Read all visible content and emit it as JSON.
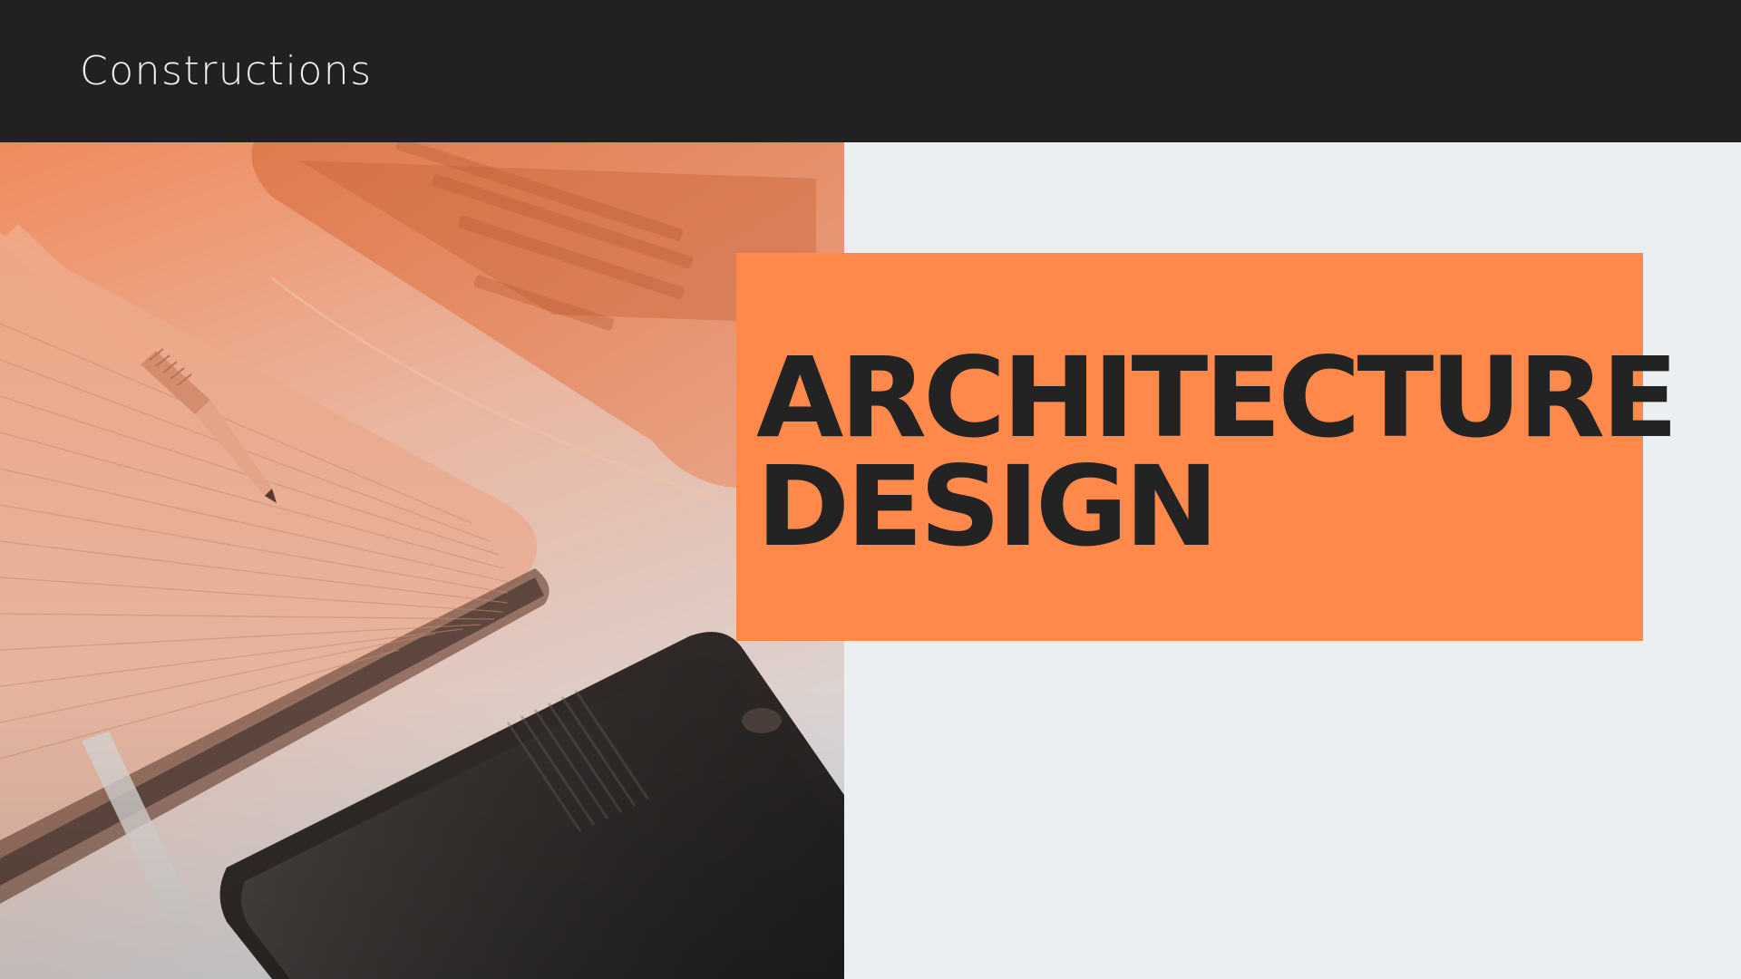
{
  "header": {
    "brand": "Constructions"
  },
  "hero": {
    "title_line1": "ARCHITECTURE",
    "title_line2": "DESIGN"
  },
  "photo": {
    "subject": "notebook-pen-laptop-phone-photo"
  },
  "colors": {
    "header_bg": "#212121",
    "accent": "#ff884b",
    "page_bg": "#eceff2",
    "title_text": "#232323",
    "brand_text": "#f2f2f2"
  }
}
